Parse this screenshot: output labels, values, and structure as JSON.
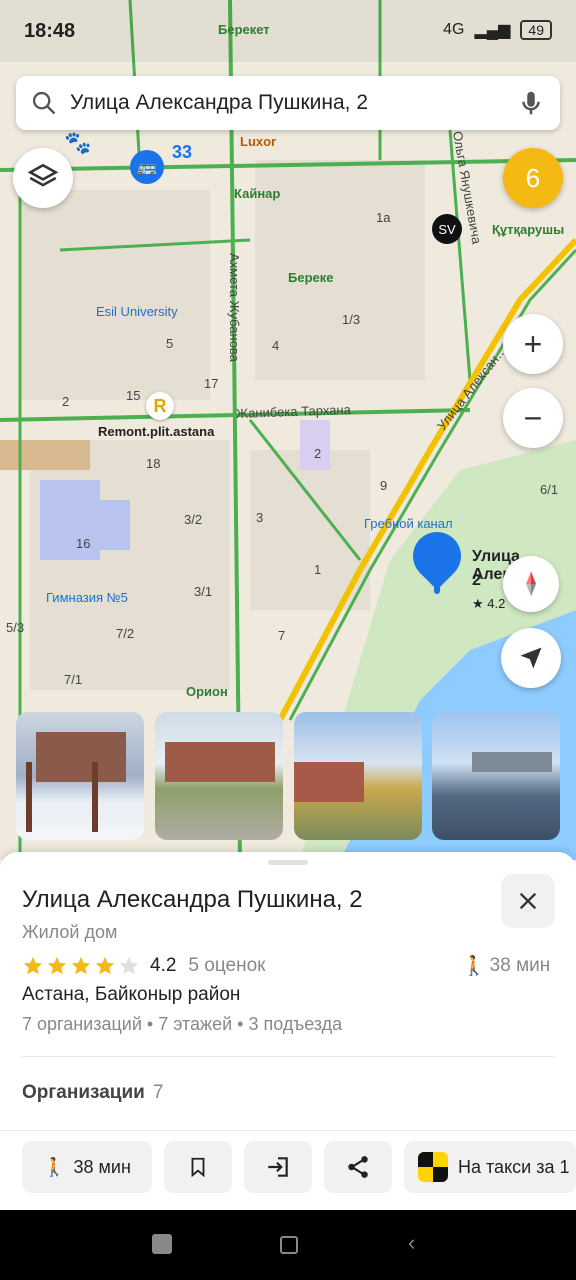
{
  "status": {
    "time": "18:48",
    "network": "4G",
    "battery": "49"
  },
  "search": {
    "query": "Улица Александра Пушкина, 2"
  },
  "map": {
    "badge_count": "6",
    "bus_number": "33",
    "labels": {
      "bereket": "Берекет",
      "luxor": "Luxor",
      "kainar": "Кайнар",
      "bereke": "Береке",
      "esil": "Esil University",
      "remont": "Remont.plit.astana",
      "zhanibek": "Жанибека Тархана",
      "akhmet": "Ахмета Жубанова",
      "grebnoy": "Гребной канал",
      "gymnasium": "Гимназия №5",
      "orion": "Орион",
      "kutkarushy": "Құтқарушы",
      "olga": "Ольга Янушкевича",
      "alexandra": "Улица Алексан…",
      "b1a": "1а",
      "b13": "1/3",
      "b4": "4",
      "b5": "5",
      "b15": "15",
      "b17": "17",
      "b18": "18",
      "b32": "3/2",
      "b16": "16",
      "b3": "3",
      "b31": "3/1",
      "b72": "7/2",
      "b7": "7",
      "b71": "7/1",
      "b53": "5/3",
      "b2": "2",
      "b9": "9",
      "b61": "6/1",
      "b1": "1",
      "b2b": "2"
    },
    "pin": {
      "title": "Улица Алекса…",
      "title2": "2",
      "rating": "★ 4.2"
    }
  },
  "place": {
    "title": "Улица Александра Пушкина, 2",
    "type": "Жилой дом",
    "rating": "4.2",
    "rating_count": "5 оценок",
    "stars_filled": 4,
    "walk_time": "38 мин",
    "address": "Астана, Байконыр район",
    "details": "7 организаций • 7 этажей • 3 подъезда",
    "orgs_label": "Организации",
    "orgs_count": "7"
  },
  "actions": {
    "walk": "38 мин",
    "taxi": "На такси за 1"
  },
  "colors": {
    "accent_blue": "#1a73e8",
    "badge_yellow": "#f5b914",
    "star": "#f5b914",
    "road_green": "#4caf50",
    "road_yellow": "#f2c200",
    "water": "#8ecbff"
  },
  "icons": [
    "search-icon",
    "mic-icon",
    "layers-icon",
    "plus-icon",
    "minus-icon",
    "compass-icon",
    "navigate-icon",
    "close-icon",
    "walk-icon",
    "bookmark-icon",
    "route-icon",
    "share-icon",
    "taxi-icon"
  ]
}
